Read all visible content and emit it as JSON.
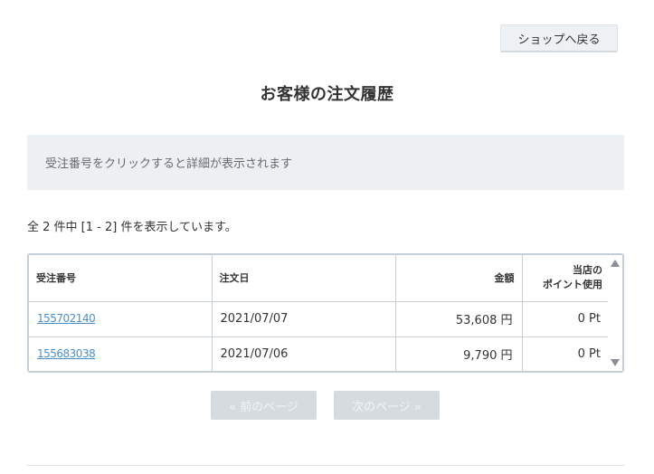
{
  "header": {
    "back_button_label": "ショップへ戻る"
  },
  "page_title": "お客様の注文履歴",
  "notice": "受注番号をクリックすると詳細が表示されます",
  "summary": "全 2 件中 [1 - 2] 件を表示しています。",
  "table": {
    "headers": {
      "order_no": "受注番号",
      "order_date": "注文日",
      "amount": "金額",
      "points_line1": "当店の",
      "points_line2": "ポイント使用"
    },
    "rows": [
      {
        "order_no": "155702140",
        "order_date": "2021/07/07",
        "amount": "53,608 円",
        "points": "0 Pt"
      },
      {
        "order_no": "155683038",
        "order_date": "2021/07/06",
        "amount": "9,790 円",
        "points": "0 Pt"
      }
    ]
  },
  "pagination": {
    "prev_label": "« 前のページ",
    "next_label": "次のページ »"
  }
}
